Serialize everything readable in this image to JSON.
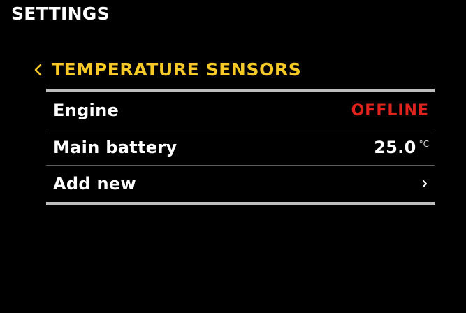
{
  "header": {
    "title": "SETTINGS"
  },
  "section": {
    "back_icon": "chevron-left-icon",
    "title": "TEMPERATURE SENSORS",
    "accent_color": "#f5c928"
  },
  "sensors": [
    {
      "label": "Engine",
      "status": "OFFLINE",
      "status_color": "#e0231c"
    },
    {
      "label": "Main battery",
      "value": "25.0",
      "unit": "°C"
    }
  ],
  "add_row": {
    "label": "Add new",
    "icon": "chevron-right-icon"
  }
}
